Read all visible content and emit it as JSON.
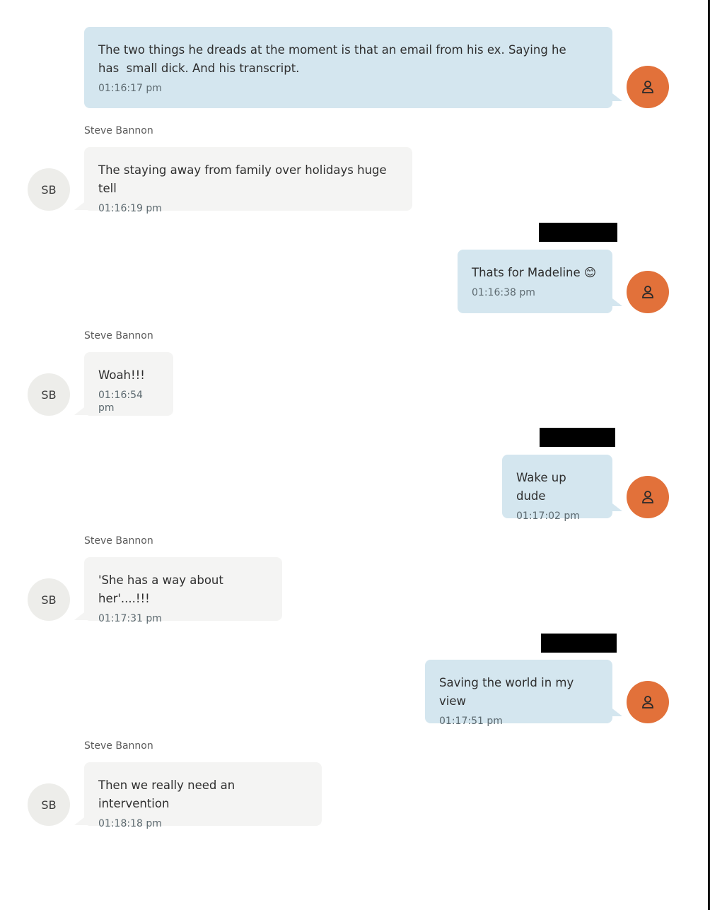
{
  "conversation": {
    "sender_name": "Steve Bannon",
    "sender_initials": "SB",
    "user_avatar_icon": "user-icon",
    "messages": [
      {
        "direction": "outgoing",
        "text": "The two things he dreads at the moment is that an email from his ex. Saying he\nhas  small dick. And his transcript.",
        "time": "01:16:17 pm"
      },
      {
        "direction": "incoming",
        "sender": "Steve Bannon",
        "text": "The staying away from family over holidays huge tell",
        "time": "01:16:19 pm"
      },
      {
        "direction": "outgoing",
        "text": "Thats for Madeline 😊",
        "time": "01:16:38 pm",
        "redacted_name": true
      },
      {
        "direction": "incoming",
        "sender": "Steve Bannon",
        "text": "Woah!!!",
        "time": "01:16:54 pm"
      },
      {
        "direction": "outgoing",
        "text": "Wake up dude",
        "time": "01:17:02 pm",
        "redacted_name": true
      },
      {
        "direction": "incoming",
        "sender": "Steve Bannon",
        "text": "'She has a way about her'....!!!",
        "time": "01:17:31 pm"
      },
      {
        "direction": "outgoing",
        "text": "Saving the world in my view",
        "time": "01:17:51 pm",
        "redacted_name": true
      },
      {
        "direction": "incoming",
        "sender": "Steve Bannon",
        "text": "Then we really need an intervention",
        "time": "01:18:18 pm"
      }
    ]
  },
  "colors": {
    "outgoing_bubble": "#d4e6ef",
    "incoming_bubble": "#f4f4f3",
    "user_avatar": "#e2713a",
    "sender_avatar": "#ededea"
  }
}
